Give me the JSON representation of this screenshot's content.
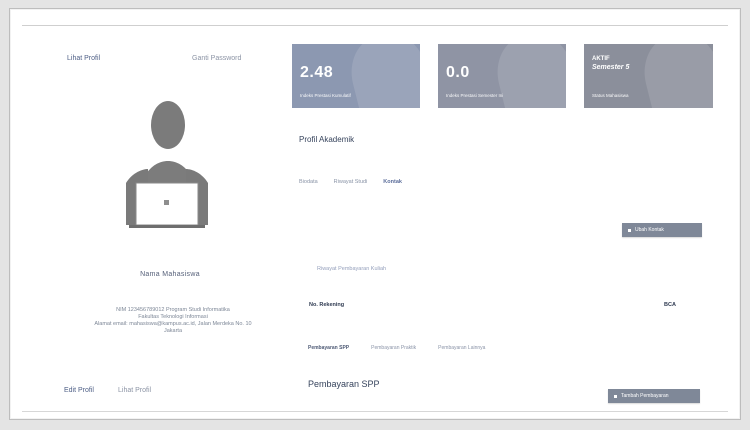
{
  "left_panel": {
    "top_left_link": "Lihat Profil",
    "top_right_link": "Ganti Password",
    "user_name": "Nama Mahasiswa",
    "profile_lines": [
      "NIM 123456789012 Program Studi Informatika",
      "Fakultas Teknologi Informasi",
      "Alamat email: mahasiswa@kampus.ac.id, Jalan Merdeka No. 10",
      "Jakarta"
    ],
    "bottom_left_link": "Edit Profil",
    "bottom_right_link": "Lihat Profil"
  },
  "stats": [
    {
      "value": "2.48",
      "caption": "Indeks Prestasi Kumulatif",
      "color": "#8c98b1"
    },
    {
      "value": "0.0",
      "caption": "Indeks Prestasi Semester Ini",
      "color": "#8f94a4"
    },
    {
      "status": "AKTIF",
      "semester": "Semester 5",
      "caption": "Status Mahasiswa",
      "color": "#8b8f9b"
    }
  ],
  "profile_section": {
    "title": "Profil Akademik",
    "tabs": [
      "Biodata",
      "Riwayat Studi",
      "Kontak"
    ],
    "active_tab": "Kontak",
    "button_label": "Ubah Kontak"
  },
  "info_section": {
    "link": "Riwayat Pembayaran Kuliah",
    "row_label": "No. Rekening",
    "row_value": "BCA"
  },
  "lower_section": {
    "tabs": [
      "Pembayaran SPP",
      "Pembayaran Praktik",
      "Pembayaran Lainnya"
    ],
    "title": "Pembayaran SPP",
    "button_label": "Tambah Pembayaran"
  }
}
